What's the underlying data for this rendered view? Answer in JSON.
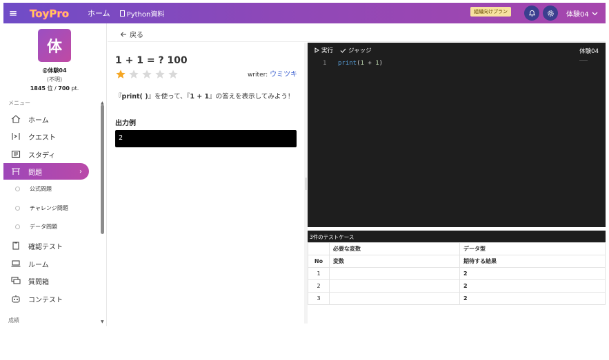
{
  "topbar": {
    "logo_text": "ToyPro",
    "home_label": "ホーム",
    "python_label": "Python資料",
    "plan_badge": "組織向けプラン",
    "user_name": "体験04",
    "colors": {
      "bar_start": "#6f4cc7",
      "bar_end": "#a646ad",
      "badge_bg": "#f7e2a0"
    }
  },
  "sidebar": {
    "avatar_char": "体",
    "user_id": "@体験04",
    "user_status": "(不明)",
    "rank": "1845",
    "rank_sep": "位 /",
    "points": "700",
    "points_unit": "pt.",
    "menu_label": "メニュー",
    "items": [
      {
        "label": "ホーム",
        "icon": "home-icon"
      },
      {
        "label": "クエスト",
        "icon": "quest-icon"
      },
      {
        "label": "スタディ",
        "icon": "study-icon"
      },
      {
        "label": "問題",
        "icon": "problem-icon",
        "active": true
      }
    ],
    "sub_items": [
      {
        "label": "公式問題"
      },
      {
        "label": "チャレンジ問題"
      },
      {
        "label": "データ問題"
      }
    ],
    "items_after": [
      {
        "label": "確認テスト",
        "icon": "test-icon"
      },
      {
        "label": "ルーム",
        "icon": "room-icon"
      },
      {
        "label": "質問箱",
        "icon": "question-box-icon"
      },
      {
        "label": "コンテスト",
        "icon": "contest-icon"
      }
    ],
    "section2_label": "成績"
  },
  "main": {
    "back_label": "戻る",
    "question_title": "1 + 1 = ? 100",
    "difficulty": {
      "rating": 1,
      "max": 5,
      "star_on": "#f5a623",
      "star_off": "#d9d9d9"
    },
    "writer_label": "writer:",
    "writer_name": "ウミツキ",
    "desc_pre": "『",
    "desc_func": "print( )",
    "desc_mid": "』を使って、『",
    "desc_expr": "1 + 1",
    "desc_post": "』の答えを表示してみよう！",
    "output_label": "出力例",
    "output_value": "2"
  },
  "editor": {
    "run_label": "実行",
    "judge_label": "ジャッジ",
    "user": "体験04",
    "line_no": "1",
    "code_fn": "print",
    "code_open": "(",
    "code_a": "1",
    "code_op": " + ",
    "code_b": "1",
    "code_close": ")"
  },
  "testcases": {
    "header": "3件のテストケース",
    "col_required_var": "必要な変数",
    "col_data_type": "データ型",
    "col_no": "No",
    "col_var": "変数",
    "col_expected": "期待する結果",
    "rows": [
      {
        "no": "1",
        "var": "",
        "expected": "2"
      },
      {
        "no": "2",
        "var": "",
        "expected": "2"
      },
      {
        "no": "3",
        "var": "",
        "expected": "2"
      }
    ]
  }
}
